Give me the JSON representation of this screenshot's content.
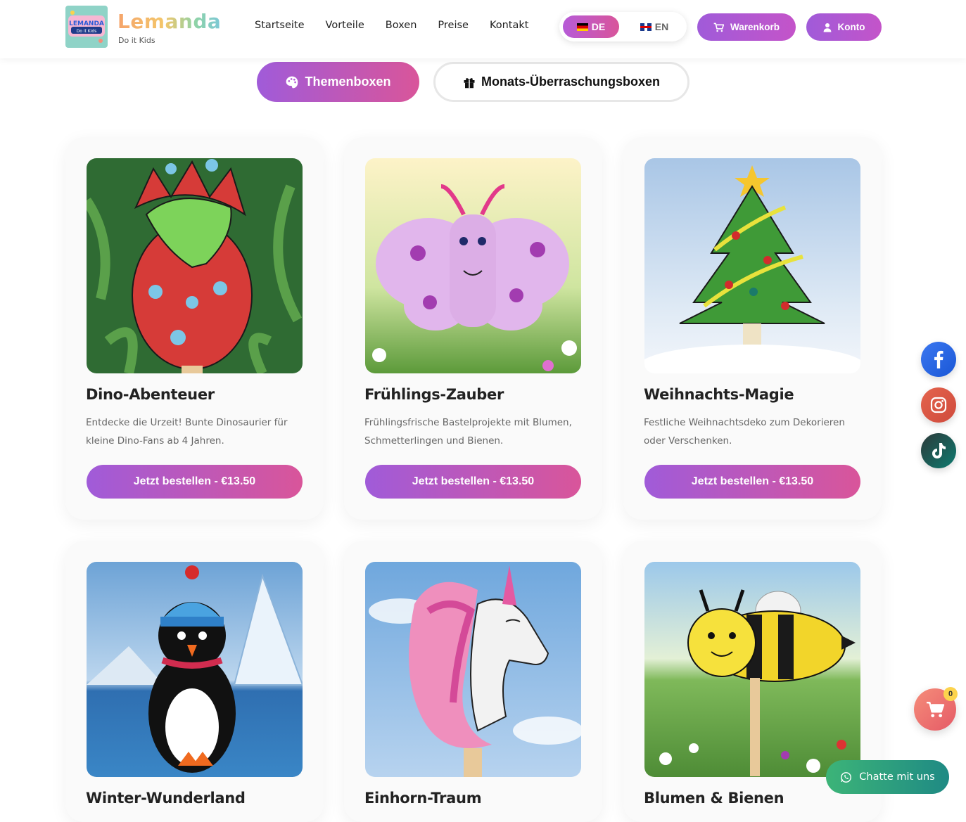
{
  "header": {
    "brand": "Lemanda",
    "tagline": "Do it Kids",
    "logo_text": "LEMANDA",
    "logo_sub": "Do it Kids",
    "nav": [
      "Startseite",
      "Vorteile",
      "Boxen",
      "Preise",
      "Kontakt"
    ],
    "lang_de": "DE",
    "lang_en": "EN",
    "cart_label": "Warenkorb",
    "account_label": "Konto"
  },
  "tabs": {
    "active": "Themenboxen",
    "inactive": "Monats-Überraschungsboxen"
  },
  "cards": [
    {
      "title": "Dino-Abenteuer",
      "desc": "Entdecke die Urzeit! Bunte Dinosaurier für kleine Dino-Fans ab 4 Jahren.",
      "button": "Jetzt bestellen - €13.50"
    },
    {
      "title": "Frühlings-Zauber",
      "desc": "Frühlingsfrische Bastelprojekte mit Blumen, Schmetterlingen und Bienen.",
      "button": "Jetzt bestellen - €13.50"
    },
    {
      "title": "Weihnachts-Magie",
      "desc": "Festliche Weihnachtsdeko zum Dekorieren oder Verschenken.",
      "button": "Jetzt bestellen - €13.50"
    },
    {
      "title": "Winter-Wunderland"
    },
    {
      "title": "Einhorn-Traum"
    },
    {
      "title": "Blumen & Bienen"
    }
  ],
  "floating": {
    "cart_count": "0",
    "chat_label": "Chatte mit uns"
  },
  "colors": {
    "accent_purple": "#a05bd9",
    "accent_pink": "#d9559a",
    "chat_green": "#3cb478"
  }
}
